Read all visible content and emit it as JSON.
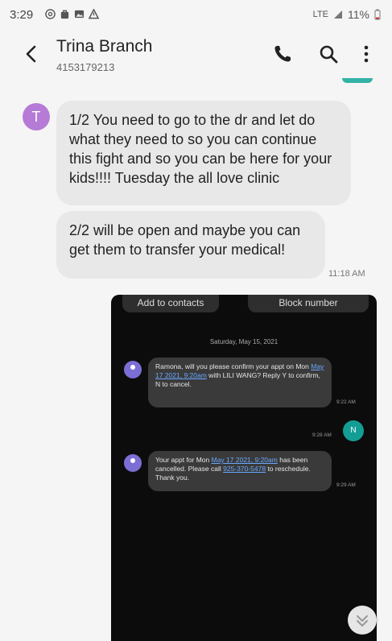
{
  "status_bar": {
    "time": "3:29",
    "network": "LTE",
    "battery": "11%"
  },
  "header": {
    "contact_name": "Trina Branch",
    "contact_number": "4153179213",
    "icons": [
      "back-arrow-icon",
      "phone-icon",
      "search-icon",
      "more-vert-icon"
    ]
  },
  "conversation": {
    "avatar_letter": "T",
    "messages": [
      {
        "text": "1/2 You need to go to the dr and let do what they need to so you can continue this fight and so you can be here for your kids!!!! Tuesday the all love clinic"
      },
      {
        "text": "2/2  will be open and maybe you can get them to transfer your medical!",
        "time": "11:18 AM"
      }
    ]
  },
  "attachment_screenshot": {
    "buttons": [
      "Add to contacts",
      "Block number"
    ],
    "date": "Saturday, May 15, 2021",
    "messages": [
      {
        "pre": "Ramona, will you please confirm your appt on Mon ",
        "link": "May 17 2021, 9:20am",
        "post": " with LILI WANG? Reply Y to confirm, N to cancel.",
        "time": "9:22 AM"
      },
      {
        "outgoing_avatar": "N",
        "time": "9:28 AM"
      },
      {
        "pre": "Your appt for Mon ",
        "link": "May 17 2021, 9:20am",
        "mid": " has been cancelled. Please call ",
        "phone": "925-370-5478",
        "post": " to reschedule. Thank you.",
        "time": "9:29 AM"
      }
    ]
  },
  "colors": {
    "background": "#f5f5f5",
    "incoming_bubble": "#e8e8e8",
    "avatar": "#b57bd6",
    "accent_teal": "#139e95",
    "link": "#6aa8ff"
  }
}
